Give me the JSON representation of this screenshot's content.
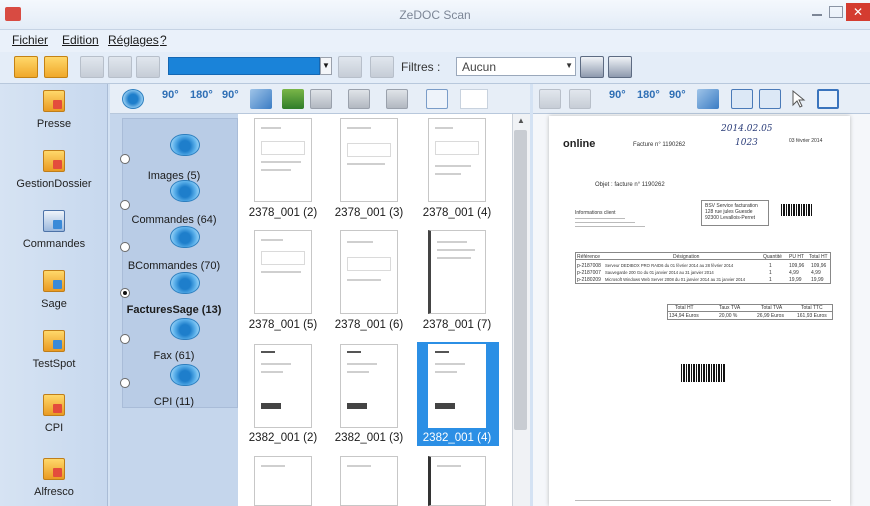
{
  "window": {
    "title": "ZeDOC Scan",
    "close_glyph": "✕"
  },
  "menu": [
    {
      "label": "Fichier"
    },
    {
      "label": "Edition"
    },
    {
      "label": "Réglages"
    },
    {
      "label": "?"
    }
  ],
  "toolbar": {
    "filtres_label": "Filtres :",
    "filtres_value": "Aucun",
    "dropdown_glyph": "▼"
  },
  "sidebar": {
    "items": [
      {
        "label": "Presse",
        "icon": "folder-icon"
      },
      {
        "label": "GestionDossier",
        "icon": "folder-icon"
      },
      {
        "label": "Commandes",
        "icon": "clipboard-icon"
      },
      {
        "label": "Sage",
        "icon": "folder-icon"
      },
      {
        "label": "TestSpot",
        "icon": "folder-icon"
      },
      {
        "label": "CPI",
        "icon": "folder-icon"
      },
      {
        "label": "Alfresco",
        "icon": "folder-icon"
      }
    ]
  },
  "viewbar": {
    "rot90": "90°",
    "rot180": "180°",
    "rotm90": "90°"
  },
  "previewbar": {
    "rot90": "90°",
    "rot180": "180°",
    "rotm90": "90°"
  },
  "tree": {
    "folders": [
      {
        "label": "Images (5)",
        "selected": false
      },
      {
        "label": "Commandes (64)",
        "selected": false
      },
      {
        "label": "BCommandes (70)",
        "selected": false
      },
      {
        "label": "FacturesSage (13)",
        "selected": true
      },
      {
        "label": "Fax (61)",
        "selected": false
      },
      {
        "label": "CPI (11)",
        "selected": false
      }
    ]
  },
  "thumbnails": [
    {
      "label": "2378_001 (2)"
    },
    {
      "label": "2378_001 (3)"
    },
    {
      "label": "2378_001 (4)"
    },
    {
      "label": "2378_001 (5)"
    },
    {
      "label": "2378_001 (6)"
    },
    {
      "label": "2378_001 (7)"
    },
    {
      "label": "2382_001 (2)"
    },
    {
      "label": "2382_001 (3)"
    },
    {
      "label": "2382_001 (4)",
      "selected": true
    }
  ],
  "preview": {
    "logo": "online",
    "facture": "Facture n° 1190262",
    "date": "03 février 2014",
    "handwritten_1": "2014.02.05",
    "handwritten_2": "1023",
    "objet": "Objet : facture n° 1190262",
    "info_title": "Informations client",
    "billing_1": "BSV Service facturation",
    "billing_2": "128 rue jules Guesde",
    "billing_3": "92300 Levallois-Perret",
    "table_head": [
      "Référence",
      "Désignation",
      "Quantité",
      "PU HT",
      "Total HT"
    ],
    "rows": [
      [
        "p-2187008",
        "Serveur DEDIBOX PRO RAID6 du 01 février 2014 au 28 février 2014",
        "1",
        "109,96",
        "109,96"
      ],
      [
        "p-2187007",
        "Sauvegarde 200 Go du 01 janvier 2014 au 31 janvier 2014",
        "1",
        "4,99",
        "4,99"
      ],
      [
        "p-2180209",
        "Microsoft Windows Web Server 2008 du 01 janvier 2014 au 31 janvier 2014",
        "1",
        "19,99",
        "19,99"
      ]
    ],
    "totals_head": [
      "Total HT",
      "Taux TVA",
      "Total TVA",
      "Total TTC"
    ],
    "totals": [
      "134,94 Euros",
      "20,00 %",
      "26,99 Euros",
      "161,93 Euros"
    ]
  }
}
